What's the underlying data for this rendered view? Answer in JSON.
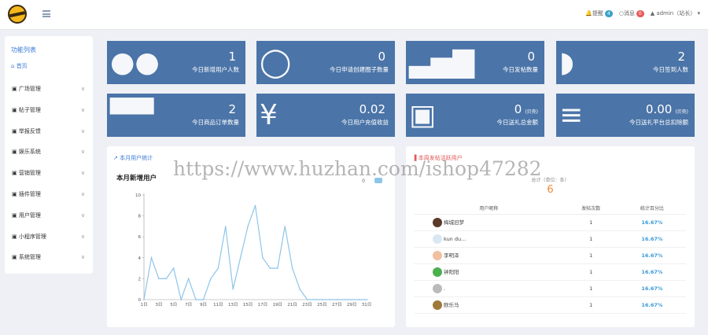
{
  "topbar": {
    "alerts_label": "提醒",
    "alerts_count": "4",
    "messages_label": "消息",
    "messages_count": "0",
    "user_label": "admin（站长）"
  },
  "sidebar": {
    "title": "功能列表",
    "home": "首页",
    "items": [
      {
        "label": "广场管理",
        "icon": "grid-icon"
      },
      {
        "label": "帖子管理",
        "icon": "file-icon"
      },
      {
        "label": "举报反馈",
        "icon": "flag-icon"
      },
      {
        "label": "娱乐系统",
        "icon": "tag-icon"
      },
      {
        "label": "营销管理",
        "icon": "wand-icon"
      },
      {
        "label": "插件管理",
        "icon": "puzzle-icon"
      },
      {
        "label": "用户管理",
        "icon": "users-icon"
      },
      {
        "label": "小程序管理",
        "icon": "sitemap-icon"
      },
      {
        "label": "系统管理",
        "icon": "cogs-icon"
      }
    ]
  },
  "cards": [
    {
      "value": "1",
      "unit": "",
      "label": "今日新增用户人数",
      "icon": "users-icon"
    },
    {
      "value": "0",
      "unit": "",
      "label": "今日申请创建圈子数量",
      "icon": "circle-icon"
    },
    {
      "value": "0",
      "unit": "",
      "label": "今日发帖数量",
      "icon": "bar-chart-icon"
    },
    {
      "value": "2",
      "unit": "",
      "label": "今日签到人数",
      "icon": "comments-icon"
    },
    {
      "value": "2",
      "unit": "",
      "label": "今日商品订单数量",
      "icon": "cart-icon"
    },
    {
      "value": "0.02",
      "unit": "",
      "label": "今日用户充值收益",
      "icon": "yen-icon"
    },
    {
      "value": "0",
      "unit": "(贝壳)",
      "label": "今日送礼总金额",
      "icon": "gift-icon"
    },
    {
      "value": "0.00",
      "unit": "(贝壳)",
      "label": "今日送礼平台总扣除额",
      "icon": "stack-icon"
    }
  ],
  "left_panel": {
    "header": "本月用户统计"
  },
  "chart_data": {
    "type": "line",
    "title": "本月新增用户",
    "legend": "0",
    "x": [
      "1日",
      "2日",
      "3日",
      "4日",
      "5日",
      "6日",
      "7日",
      "8日",
      "9日",
      "10日",
      "11日",
      "12日",
      "13日",
      "14日",
      "15日",
      "16日",
      "17日",
      "18日",
      "19日",
      "20日",
      "21日",
      "22日",
      "23日",
      "24日",
      "25日",
      "26日",
      "27日",
      "28日",
      "29日",
      "30日",
      "31日"
    ],
    "x_tick_labels": [
      "1日",
      "3日",
      "5日",
      "7日",
      "9日",
      "11日",
      "13日",
      "15日",
      "17日",
      "19日",
      "21日",
      "23日",
      "25日",
      "27日",
      "29日",
      "31日"
    ],
    "values": [
      0,
      4,
      2,
      2,
      3,
      0,
      2,
      0,
      0,
      2,
      3,
      7,
      1,
      4,
      7,
      9,
      4,
      3,
      3,
      7,
      3,
      1,
      0,
      0,
      0,
      0,
      0,
      0,
      0,
      0,
      0
    ],
    "ylim": [
      0,
      10
    ],
    "y_ticks": [
      0,
      2,
      4,
      6,
      8,
      10
    ],
    "color": "#8ec5ea"
  },
  "right_panel": {
    "header": "本周发帖活跃用户",
    "total_label": "总计（单位：条）",
    "total_value": "6",
    "columns": [
      "用户昵称",
      "发帖次数",
      "统计百分比"
    ],
    "rows": [
      {
        "name": "梅城旧梦",
        "count": "1",
        "pct": "16.67%",
        "color": "#5a3a2a"
      },
      {
        "name": "kun du...",
        "count": "1",
        "pct": "16.67%",
        "color": "#d8e8f2"
      },
      {
        "name": "李明泽",
        "count": "1",
        "pct": "16.67%",
        "color": "#f0c0a0"
      },
      {
        "name": "钟阳阳",
        "count": "1",
        "pct": "16.67%",
        "color": "#4caf50"
      },
      {
        "name": ".",
        "count": "1",
        "pct": "16.67%",
        "color": "#bbbbbb"
      },
      {
        "name": "欧乐马",
        "count": "1",
        "pct": "16.67%",
        "color": "#a0783a"
      }
    ]
  },
  "watermark": "https://www.huzhan.com/ishop47282"
}
